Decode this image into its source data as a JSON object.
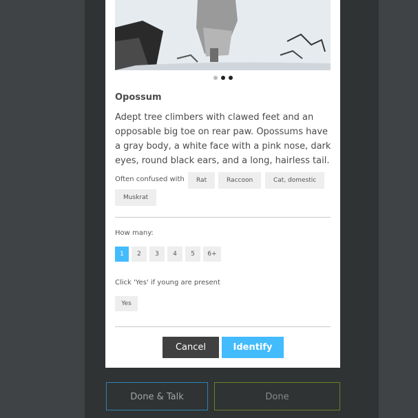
{
  "carousel": {
    "dot_count": 3,
    "active_index": 0
  },
  "animal": {
    "name": "Opossum",
    "description": "Adept tree climbers with clawed feet and an opposable big toe on rear paw. Opossums have a gray body, a white face with a pink nose, dark eyes, round black ears, and a long, hairless tail."
  },
  "confused": {
    "label": "Often confused with",
    "items": [
      "Rat",
      "Raccoon",
      "Cat, domestic",
      "Muskrat"
    ]
  },
  "how_many": {
    "label": "How many:",
    "options": [
      "1",
      "2",
      "3",
      "4",
      "5",
      "6+"
    ],
    "selected": "1"
  },
  "young": {
    "label": "Click 'Yes' if young are present",
    "yes_label": "Yes"
  },
  "actions": {
    "cancel_label": "Cancel",
    "identify_label": "Identify"
  },
  "footer": {
    "done_talk_label": "Done & Talk",
    "done_label": "Done"
  },
  "colors": {
    "accent": "#43bbfd",
    "dark_button": "#404040",
    "talk_border": "#2e83b4",
    "done_border": "#6a7f2e"
  }
}
